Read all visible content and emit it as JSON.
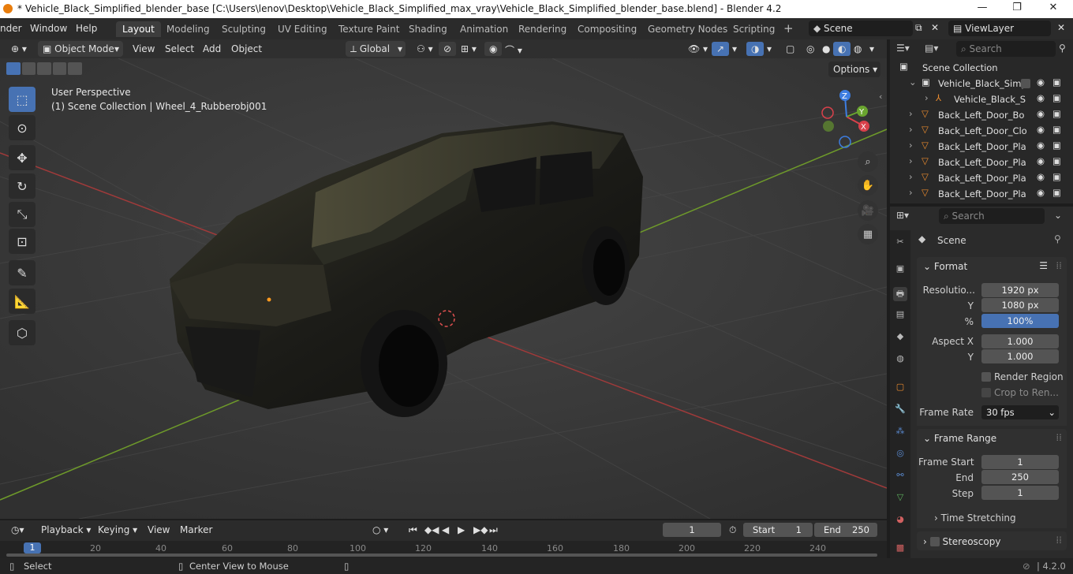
{
  "window": {
    "title": "* Vehicle_Black_Simplified_blender_base [C:\\Users\\lenov\\Desktop\\Vehicle_Black_Simplified_max_vray\\Vehicle_Black_Simplified_blender_base.blend] - Blender 4.2",
    "minimize": "—",
    "maximize": "❐",
    "close": "✕"
  },
  "menu": {
    "items": [
      "nder",
      "Window",
      "Help"
    ],
    "workspaces": [
      "Layout",
      "Modeling",
      "Sculpting",
      "UV Editing",
      "Texture Paint",
      "Shading",
      "Animation",
      "Rendering",
      "Compositing",
      "Geometry Nodes",
      "Scripting"
    ],
    "add_workspace": "+",
    "scene": "Scene",
    "view_layer": "ViewLayer"
  },
  "viewport_header": {
    "mode": "Object Mode",
    "menus": [
      "View",
      "Select",
      "Add",
      "Object"
    ],
    "orientation": "Global",
    "options": "Options"
  },
  "viewport": {
    "perspective": "User Perspective",
    "collection_info": "(1) Scene Collection | Wheel_4_Rubberobj001",
    "gizmo": {
      "x": "X",
      "y": "Y",
      "z": "Z"
    }
  },
  "outliner": {
    "search_placeholder": "Search",
    "root": "Scene Collection",
    "items": [
      "Vehicle_Black_Simp",
      "Vehicle_Black_S",
      "Back_Left_Door_Bo",
      "Back_Left_Door_Clo",
      "Back_Left_Door_Pla",
      "Back_Left_Door_Pla",
      "Back_Left_Door_Pla",
      "Back_Left_Door_Pla"
    ]
  },
  "properties": {
    "search_placeholder": "Search",
    "context": "Scene",
    "format": {
      "title": "Format",
      "resolution_label": "Resolutio...",
      "resolution_x": "1920 px",
      "y_label": "Y",
      "resolution_y": "1080 px",
      "percent_label": "%",
      "percent": "100%",
      "aspect_x_label": "Aspect X",
      "aspect_x": "1.000",
      "aspect_y_label": "Y",
      "aspect_y": "1.000",
      "render_region": "Render Region",
      "crop": "Crop to Ren...",
      "frame_rate_label": "Frame Rate",
      "frame_rate": "30 fps"
    },
    "frame_range": {
      "title": "Frame Range",
      "start_label": "Frame Start",
      "start": "1",
      "end_label": "End",
      "end": "250",
      "step_label": "Step",
      "step": "1",
      "time_stretching": "Time Stretching"
    },
    "stereoscopy": "Stereoscopy"
  },
  "timeline": {
    "menus": [
      "Playback",
      "Keying",
      "View",
      "Marker"
    ],
    "current_frame": "1",
    "start_label": "Start",
    "start": "1",
    "end_label": "End",
    "end": "250",
    "ticks": [
      "1",
      "20",
      "40",
      "60",
      "80",
      "100",
      "120",
      "140",
      "160",
      "180",
      "200",
      "220",
      "240"
    ]
  },
  "statusbar": {
    "select": "Select",
    "center_view": "Center View to Mouse",
    "version": "4.2.0"
  }
}
